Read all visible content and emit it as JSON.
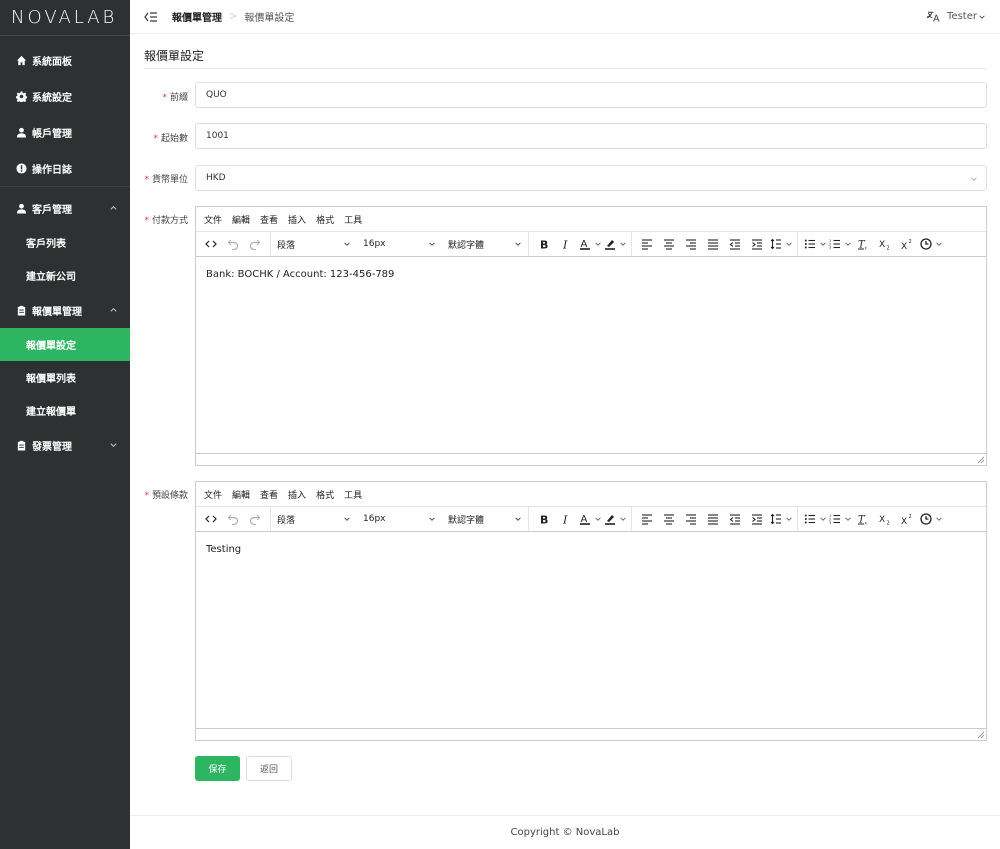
{
  "sidebar": {
    "logo": "NOVALAB",
    "items": [
      {
        "label": "系統面板",
        "icon": "home-icon"
      },
      {
        "label": "系統設定",
        "icon": "gear-icon"
      },
      {
        "label": "帳戶管理",
        "icon": "user-icon"
      },
      {
        "label": "操作日誌",
        "icon": "alert-icon"
      },
      {
        "label": "客戶管理",
        "icon": "user-icon",
        "children": [
          {
            "label": "客戶列表"
          },
          {
            "label": "建立新公司"
          }
        ]
      },
      {
        "label": "報價單管理",
        "icon": "clipboard-icon",
        "children": [
          {
            "label": "報價單設定",
            "active": true
          },
          {
            "label": "報價單列表"
          },
          {
            "label": "建立報價單"
          }
        ]
      },
      {
        "label": "發票管理",
        "icon": "clipboard-icon"
      }
    ]
  },
  "header": {
    "breadcrumb_parent": "報價單管理",
    "breadcrumb_separator": ">",
    "breadcrumb_current": "報價單設定",
    "user_name": "Tester"
  },
  "page": {
    "title": "報價單設定",
    "fields": {
      "prefix": {
        "label": "前綴",
        "value": "QUO"
      },
      "start_number": {
        "label": "起始數",
        "value": "1001"
      },
      "currency": {
        "label": "貨幣單位",
        "value": "HKD"
      },
      "payment": {
        "label": "付款方式",
        "content": "Bank: BOCHK / Account: 123-456-789"
      },
      "terms": {
        "label": "預設條款",
        "content": "Testing"
      }
    },
    "save_label": "保存",
    "back_label": "返回"
  },
  "editor": {
    "menus": [
      "文件",
      "編輯",
      "查看",
      "插入",
      "格式",
      "工具"
    ],
    "block_format": "段落",
    "font_size": "16px",
    "font_family": "默認字體"
  },
  "footer": {
    "copyright": "Copyright © NovaLab"
  },
  "colors": {
    "accent": "#2db562",
    "sidebar": "#2d3132",
    "required": "#e4393c"
  }
}
